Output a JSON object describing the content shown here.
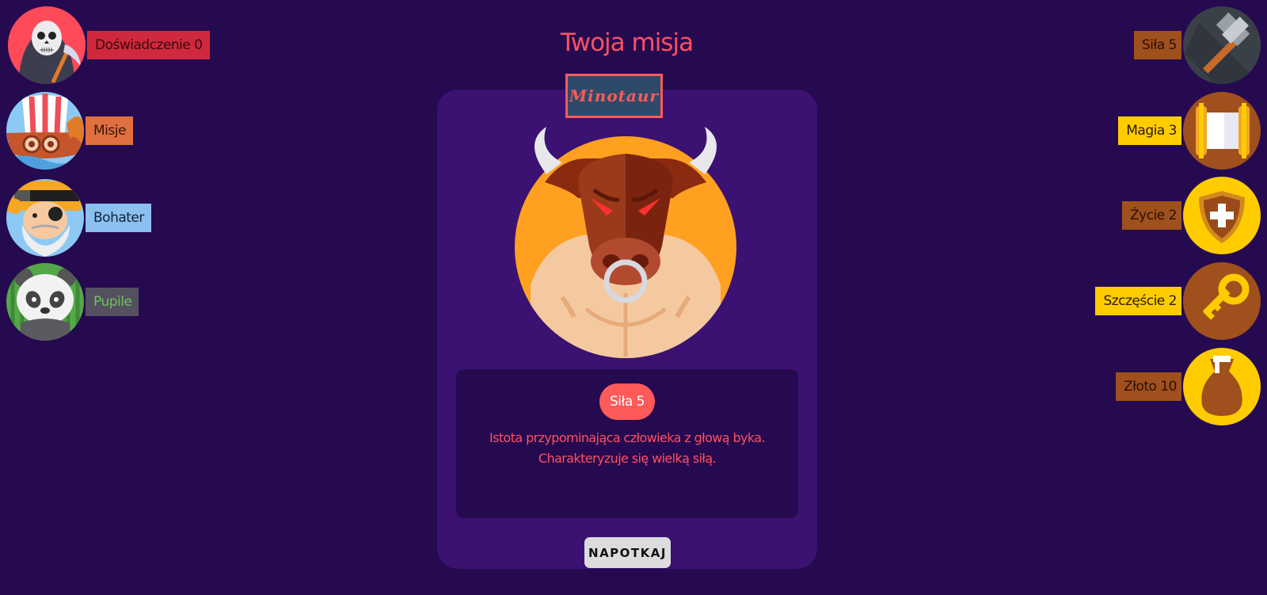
{
  "nav": {
    "items": [
      {
        "label": "Doświadczenie 0",
        "label_bg": "#d0283c",
        "label_color": "#3a0a10"
      },
      {
        "label": "Misje",
        "label_bg": "#e07040",
        "label_color": "#3a1408"
      },
      {
        "label": "Bohater",
        "label_bg": "#8cc0f0",
        "label_color": "#10233a"
      },
      {
        "label": "Pupile",
        "label_bg": "#555060",
        "label_color": "#6ec060"
      }
    ]
  },
  "stats": {
    "items": [
      {
        "label": "Siła 5",
        "icon": "hammer-icon",
        "label_bg": "#a0501c",
        "label_color": "#2a1006"
      },
      {
        "label": "Magia 3",
        "icon": "scroll-icon",
        "label_bg": "#ffcc00",
        "label_color": "#2a1a00"
      },
      {
        "label": "Życie 2",
        "icon": "shield-icon",
        "label_bg": "#a0501c",
        "label_color": "#2a1006"
      },
      {
        "label": "Szczęście 2",
        "icon": "key-icon",
        "label_bg": "#ffcc00",
        "label_color": "#2a1a00"
      },
      {
        "label": "Złoto 10",
        "icon": "money-bag-icon",
        "label_bg": "#a0501c",
        "label_color": "#2a1006"
      }
    ]
  },
  "mission": {
    "title": "Twoja misja",
    "monster_name": "Minotaur",
    "power": "Siła 5",
    "description": "Istota przypominająca człowieka z głową byka. Charakteryzuje się wielką siłą.",
    "button": "NAPOTKAJ"
  },
  "colors": {
    "background": "#250a50",
    "card": "#3b1172",
    "accent": "#ff5a5a"
  }
}
